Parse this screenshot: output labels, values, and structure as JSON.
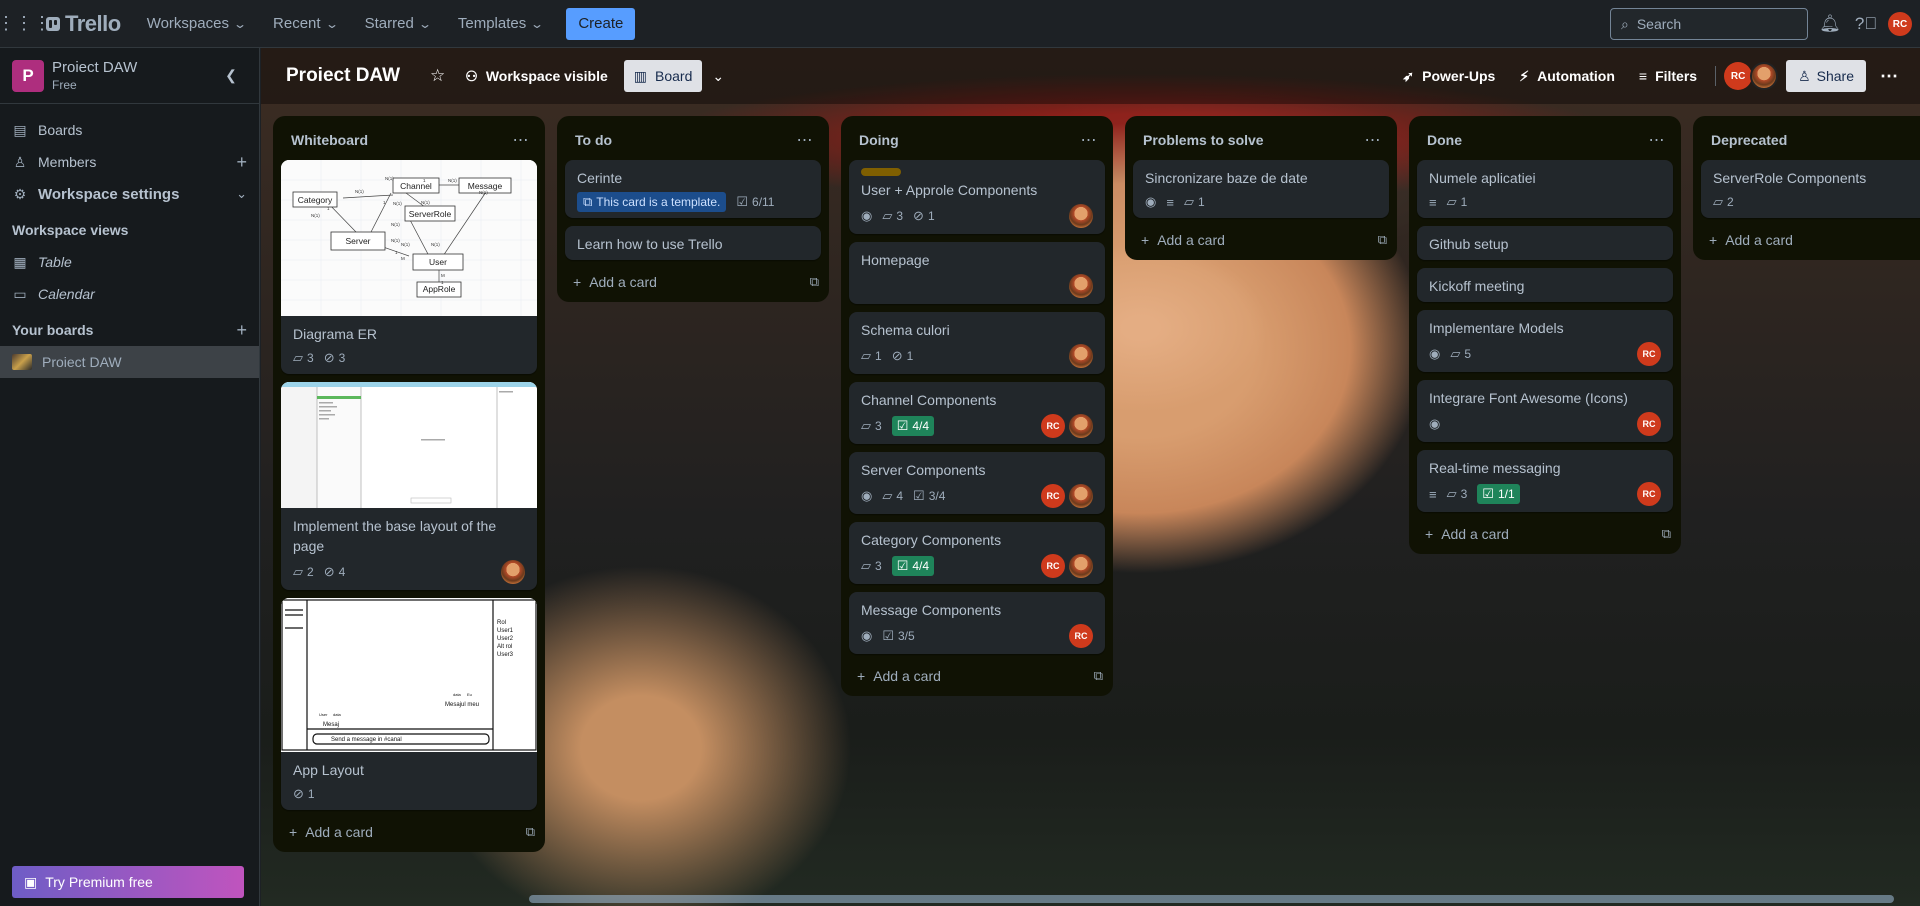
{
  "topnav": {
    "apps_icon": "grid-icon",
    "logo": "Trello",
    "menu": [
      {
        "label": "Workspaces"
      },
      {
        "label": "Recent"
      },
      {
        "label": "Starred"
      },
      {
        "label": "Templates"
      }
    ],
    "create_label": "Create",
    "search_placeholder": "Search",
    "avatar_initials": "RC"
  },
  "sidebar": {
    "workspace_initial": "P",
    "workspace_name": "Proiect DAW",
    "workspace_plan": "Free",
    "items": [
      {
        "label": "Boards",
        "icon": "trello-board-icon"
      },
      {
        "label": "Members",
        "icon": "person-icon"
      },
      {
        "label": "Workspace settings",
        "icon": "gear-icon"
      }
    ],
    "views_header": "Workspace views",
    "views": [
      {
        "label": "Table"
      },
      {
        "label": "Calendar"
      }
    ],
    "boards_header": "Your boards",
    "boards": [
      {
        "label": "Proiect DAW"
      }
    ],
    "premium_label": "Try Premium free"
  },
  "board": {
    "title": "Proiect DAW",
    "visibility_label": "Workspace visible",
    "view_label": "Board",
    "powerups_label": "Power-Ups",
    "automation_label": "Automation",
    "filters_label": "Filters",
    "member_initials": "RC",
    "share_label": "Share",
    "add_card_label": "Add a card",
    "lists": [
      {
        "title": "Whiteboard",
        "cards": [
          {
            "title": "Diagrama ER",
            "comments": "3",
            "attachments": "3"
          },
          {
            "title": "Implement the base layout of the page",
            "comments": "2",
            "attachments": "4"
          },
          {
            "title": "App Layout",
            "attachments": "1"
          }
        ]
      },
      {
        "title": "To do",
        "cards": [
          {
            "title": "Cerinte",
            "template_label": "This card is a template.",
            "checklist": "6/11"
          },
          {
            "title": "Learn how to use Trello"
          }
        ]
      },
      {
        "title": "Doing",
        "cards": [
          {
            "title": "User + Approle Components",
            "comments": "3",
            "attachments": "1"
          },
          {
            "title": "Homepage"
          },
          {
            "title": "Schema culori",
            "comments": "1",
            "attachments": "1"
          },
          {
            "title": "Channel Components",
            "comments": "3",
            "checklist": "4/4"
          },
          {
            "title": "Server Components",
            "comments": "4",
            "checklist": "3/4"
          },
          {
            "title": "Category Components",
            "comments": "3",
            "checklist": "4/4"
          },
          {
            "title": "Message Components",
            "checklist": "3/5"
          }
        ]
      },
      {
        "title": "Problems to solve",
        "cards": [
          {
            "title": "Sincronizare baze de date",
            "comments": "1"
          }
        ]
      },
      {
        "title": "Done",
        "cards": [
          {
            "title": "Numele aplicatiei",
            "comments": "1"
          },
          {
            "title": "Github setup"
          },
          {
            "title": "Kickoff meeting"
          },
          {
            "title": "Implementare Models",
            "comments": "5"
          },
          {
            "title": "Integrare Font Awesome (Icons)"
          },
          {
            "title": "Real-time messaging",
            "comments": "3",
            "checklist": "1/1"
          }
        ]
      },
      {
        "title": "Deprecated",
        "cards": [
          {
            "title": "ServerRole Components",
            "comments": "2"
          }
        ]
      }
    ],
    "er_diagram": {
      "entities": [
        "Channel",
        "Message",
        "Category",
        "ServerRole",
        "Server",
        "User",
        "AppRole"
      ],
      "relations": [
        "N(1)",
        "N(1)",
        "1",
        "N(1)",
        "N(1)",
        "N(1)",
        "1",
        "1",
        "N(1)",
        "N(1)",
        "N(1)",
        "N(1)",
        "M",
        "1",
        "N(1)",
        "M",
        "1",
        "N(1)"
      ]
    },
    "app_layout_sketch": {
      "role_list": [
        "Rol",
        "User1",
        "User2",
        "Alt rol",
        "User3"
      ],
      "author": "User",
      "date": "data",
      "message_label": "Mesaj",
      "own_meta": [
        "data",
        "Eu"
      ],
      "own_message": "Mesajul meu",
      "input_placeholder": "Send a message in #canal"
    },
    "colors": {
      "accent": "#579dff",
      "done_badge": "#1f845a",
      "template_badge": "#1c4d8c",
      "member_red": "#cf3a1c",
      "label_yellow": "#7f5f01"
    }
  }
}
